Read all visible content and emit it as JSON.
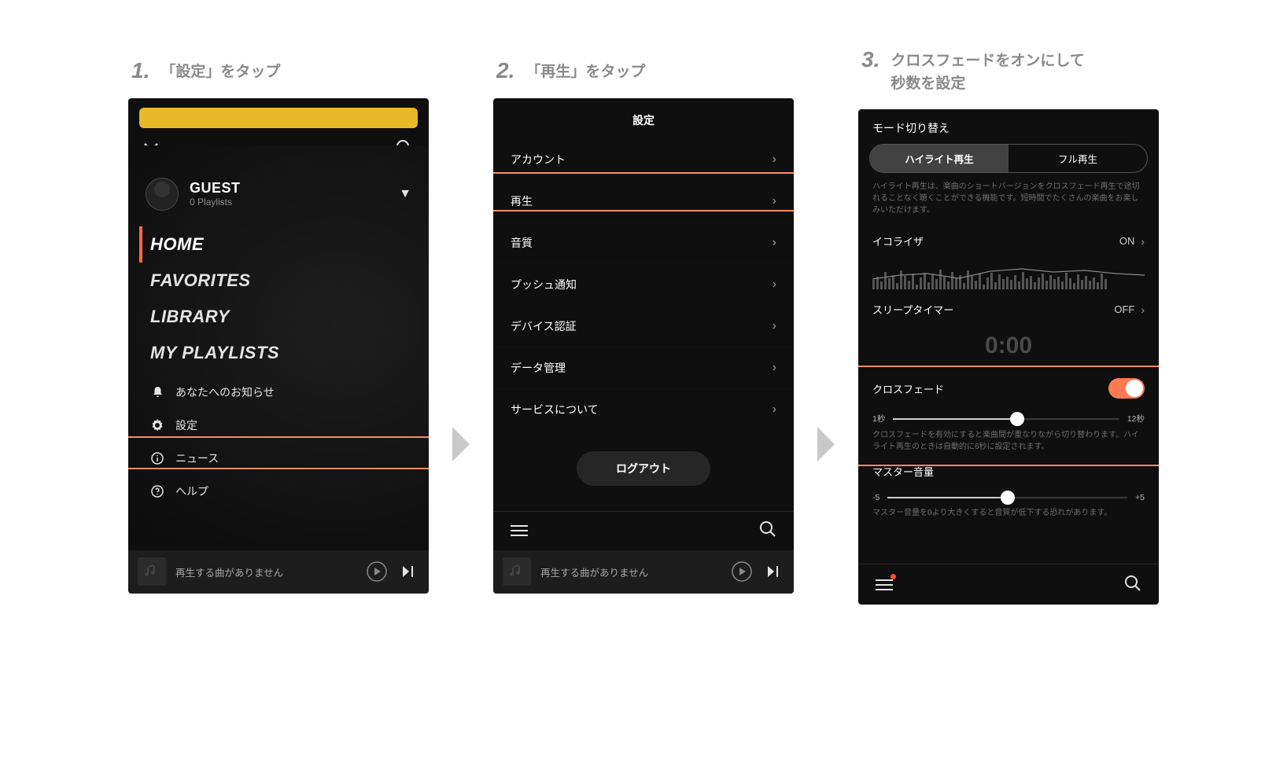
{
  "steps": [
    {
      "num": "1.",
      "text": "「設定」をタップ"
    },
    {
      "num": "2.",
      "text": "「再生」をタップ"
    },
    {
      "num": "3.",
      "text": "クロスフェードをオンにして\n秒数を設定"
    }
  ],
  "screen1": {
    "user_name": "GUEST",
    "user_sub": "0 Playlists",
    "nav": [
      "HOME",
      "FAVORITES",
      "LIBRARY",
      "MY PLAYLISTS"
    ],
    "sub": [
      {
        "icon": "bell",
        "label": "あなたへのお知らせ"
      },
      {
        "icon": "gear",
        "label": "設定"
      },
      {
        "icon": "info",
        "label": "ニュース"
      },
      {
        "icon": "help",
        "label": "ヘルプ"
      }
    ],
    "playbar_text": "再生する曲がありません"
  },
  "screen2": {
    "title": "設定",
    "items": [
      "アカウント",
      "再生",
      "音質",
      "プッシュ通知",
      "デバイス認証",
      "データ管理",
      "サービスについて"
    ],
    "logout": "ログアウト",
    "playbar_text": "再生する曲がありません"
  },
  "screen3": {
    "mode_title": "モード切り替え",
    "seg_a": "ハイライト再生",
    "seg_b": "フル再生",
    "mode_desc": "ハイライト再生は、楽曲のショートバージョンをクロスフェード再生で途切れることなく聴くことができる機能です。短時間でたくさんの楽曲をお楽しみいただけます。",
    "eq_label": "イコライザ",
    "eq_value": "ON",
    "sleep_label": "スリープタイマー",
    "sleep_value": "OFF",
    "timer": "0:00",
    "crossfade_label": "クロスフェード",
    "crossfade_min": "1秒",
    "crossfade_max": "12秒",
    "crossfade_desc": "クロスフェードを有効にすると楽曲間が重なりながら切り替わります。ハイライト再生のときは自動的に6秒に設定されます。",
    "master_label": "マスター音量",
    "master_min": "-5",
    "master_max": "+5",
    "master_desc": "マスター音量を0より大きくすると音質が低下する恐れがあります。"
  },
  "colors": {
    "accent": "#ff7a52",
    "highlight": "#ff8a63"
  }
}
